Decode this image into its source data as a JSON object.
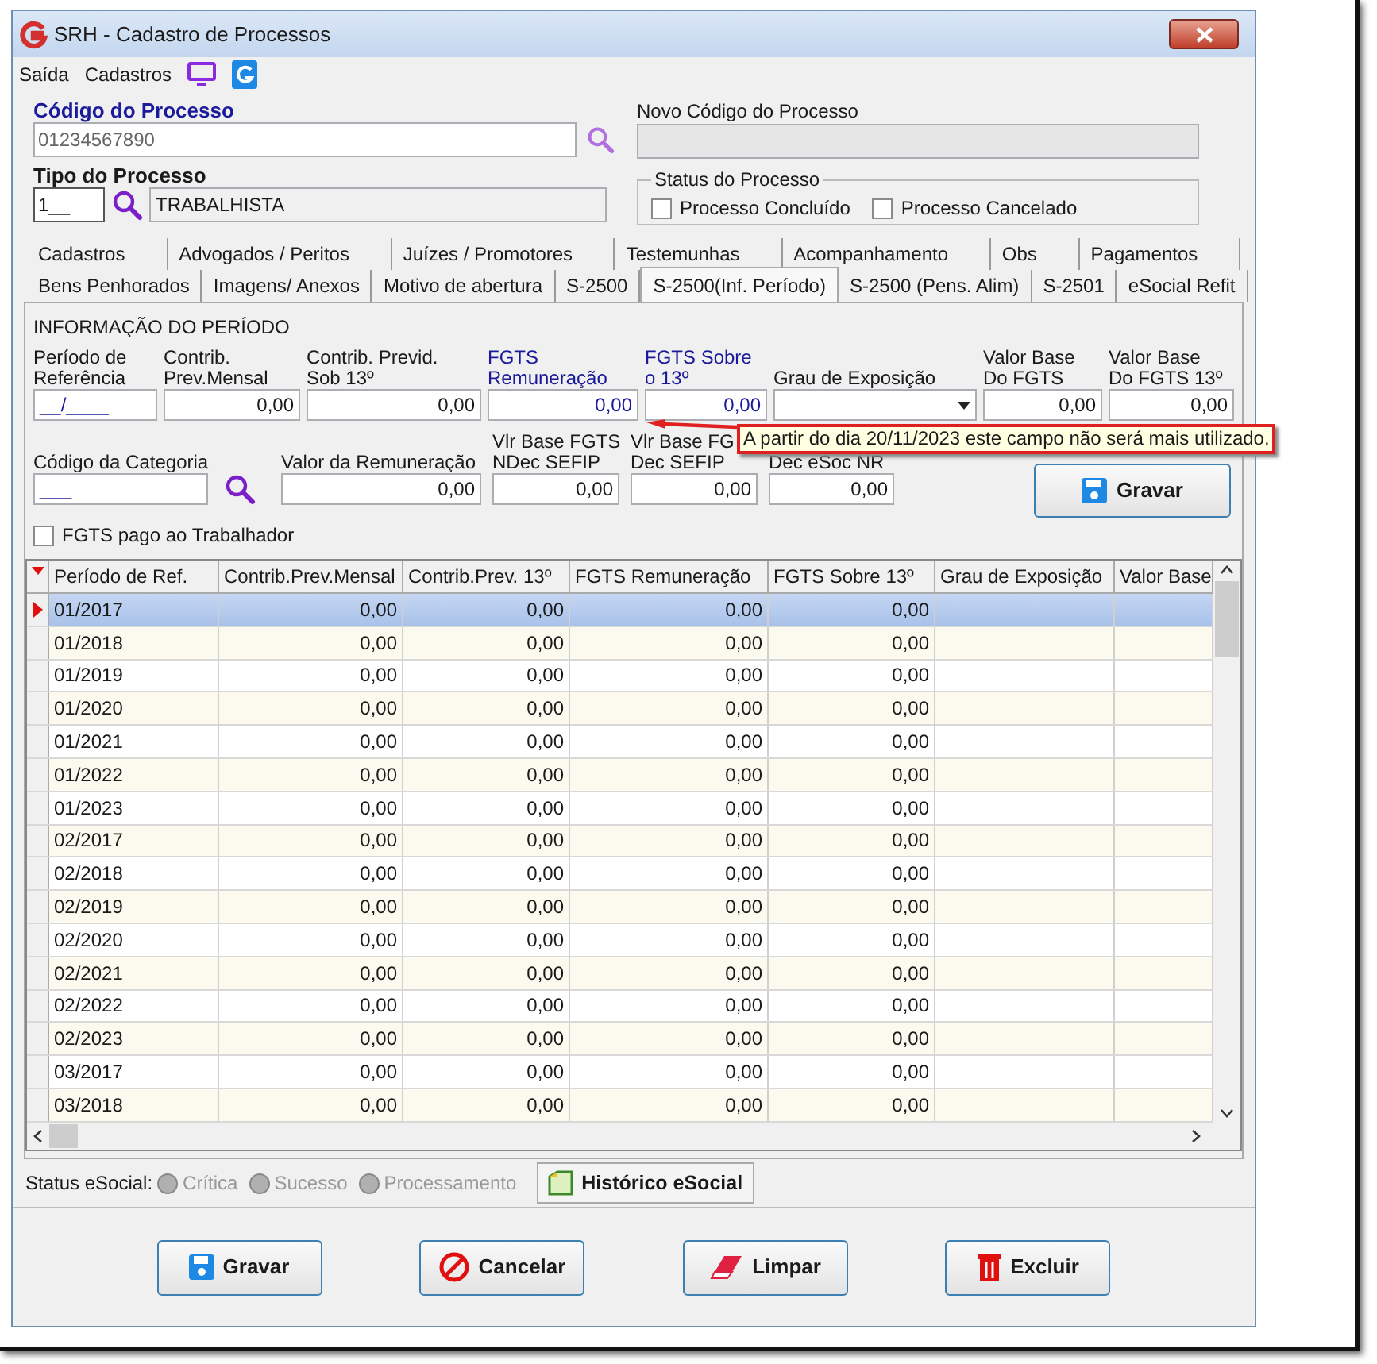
{
  "window": {
    "title": "SRH - Cadastro de Processos"
  },
  "menu": [
    {
      "label": "Saída",
      "kind": "text"
    },
    {
      "label": "Cadastros",
      "kind": "text"
    },
    {
      "kind": "monitor"
    },
    {
      "kind": "logo"
    }
  ],
  "codigo": {
    "label": "Código do Processo",
    "value": "01234567890"
  },
  "novo_codigo": {
    "label": "Novo Código do Processo",
    "disabled": true
  },
  "tipo": {
    "label": "Tipo do Processo",
    "code": "1__",
    "description": "TRABALHISTA"
  },
  "status": {
    "title": "Status do Processo",
    "options": [
      {
        "label": "Processo Concluído",
        "checked": false
      },
      {
        "label": "Processo Cancelado",
        "checked": false
      }
    ]
  },
  "tabs_row1": [
    {
      "label": "Cadastros",
      "selected": false
    },
    {
      "label": "Advogados / Peritos",
      "selected": false
    },
    {
      "label": "Juízes / Promotores",
      "selected": false
    },
    {
      "label": "Testemunhas",
      "selected": false
    },
    {
      "label": "Acompanhamento",
      "selected": false
    },
    {
      "label": "Obs",
      "selected": false
    },
    {
      "label": "Pagamentos",
      "selected": false
    }
  ],
  "tabs_row2": [
    {
      "label": "Bens Penhorados",
      "selected": false
    },
    {
      "label": "Imagens/ Anexos",
      "selected": false
    },
    {
      "label": "Motivo de abertura",
      "selected": false
    },
    {
      "label": "S-2500",
      "selected": false
    },
    {
      "label": "S-2500(Inf. Período)",
      "selected": true
    },
    {
      "label": "S-2500 (Pens. Alim)",
      "selected": false
    },
    {
      "label": "S-2501",
      "selected": false
    },
    {
      "label": "eSocial Refit",
      "selected": false
    }
  ],
  "group": {
    "title": "INFORMAÇÃO DO PERÍODO",
    "fields_row1": [
      {
        "label": [
          "Período de",
          "Referência"
        ],
        "value": "__/____",
        "kind": "mask",
        "highlight": false
      },
      {
        "label": [
          "Contrib.",
          "Prev.Mensal"
        ],
        "value": "0,00",
        "kind": "number",
        "highlight": false
      },
      {
        "label": [
          "Contrib. Previd.",
          "Sob 13º"
        ],
        "value": "0,00",
        "kind": "number",
        "highlight": false
      },
      {
        "label": [
          "FGTS",
          "Remuneração"
        ],
        "value": "0,00",
        "kind": "number",
        "highlight": true
      },
      {
        "label": [
          "FGTS Sobre",
          "o 13º"
        ],
        "value": "0,00",
        "kind": "number",
        "highlight": true
      },
      {
        "label": [
          "Grau de Exposição"
        ],
        "kind": "select",
        "highlight": false
      },
      {
        "label": [
          "Valor Base",
          "Do FGTS"
        ],
        "value": "0,00",
        "kind": "number",
        "highlight": false
      },
      {
        "label": [
          "Valor Base",
          "Do FGTS 13º"
        ],
        "value": "0,00",
        "kind": "number",
        "highlight": false
      }
    ],
    "tooltip": "A partir do dia 20/11/2023 este campo não será mais utilizado.",
    "fields_row2": [
      {
        "label": [
          "Código da Categoria"
        ],
        "value": "___",
        "kind": "lookup"
      },
      {
        "label": [
          "Valor da Remuneração"
        ],
        "value": "0,00",
        "kind": "number"
      },
      {
        "label": [
          "Vlr Base FGTS",
          "NDec SEFIP"
        ],
        "value": "0,00",
        "kind": "number"
      },
      {
        "label": [
          "Vlr Base FG",
          "Dec SEFIP"
        ],
        "value": "0,00",
        "kind": "number"
      },
      {
        "label": [
          "Dec eSoc NR"
        ],
        "value": "0,00",
        "kind": "number"
      }
    ],
    "save_button": "Gravar",
    "fgts_pago": {
      "label": "FGTS pago ao Trabalhador",
      "checked": false
    }
  },
  "table": {
    "columns": [
      "Período de Ref.",
      "Contrib.Prev.Mensal",
      "Contrib.Prev. 13º",
      "FGTS Remuneração",
      "FGTS Sobre 13º",
      "Grau de Exposição",
      "Valor Base"
    ],
    "rows": [
      {
        "cells": [
          "01/2017",
          "0,00",
          "0,00",
          "0,00",
          "0,00"
        ],
        "selected": true
      },
      {
        "cells": [
          "01/2018",
          "0,00",
          "0,00",
          "0,00",
          "0,00"
        ],
        "selected": false
      },
      {
        "cells": [
          "01/2019",
          "0,00",
          "0,00",
          "0,00",
          "0,00"
        ],
        "selected": false
      },
      {
        "cells": [
          "01/2020",
          "0,00",
          "0,00",
          "0,00",
          "0,00"
        ],
        "selected": false
      },
      {
        "cells": [
          "01/2021",
          "0,00",
          "0,00",
          "0,00",
          "0,00"
        ],
        "selected": false
      },
      {
        "cells": [
          "01/2022",
          "0,00",
          "0,00",
          "0,00",
          "0,00"
        ],
        "selected": false
      },
      {
        "cells": [
          "01/2023",
          "0,00",
          "0,00",
          "0,00",
          "0,00"
        ],
        "selected": false
      },
      {
        "cells": [
          "02/2017",
          "0,00",
          "0,00",
          "0,00",
          "0,00"
        ],
        "selected": false
      },
      {
        "cells": [
          "02/2018",
          "0,00",
          "0,00",
          "0,00",
          "0,00"
        ],
        "selected": false
      },
      {
        "cells": [
          "02/2019",
          "0,00",
          "0,00",
          "0,00",
          "0,00"
        ],
        "selected": false
      },
      {
        "cells": [
          "02/2020",
          "0,00",
          "0,00",
          "0,00",
          "0,00"
        ],
        "selected": false
      },
      {
        "cells": [
          "02/2021",
          "0,00",
          "0,00",
          "0,00",
          "0,00"
        ],
        "selected": false
      },
      {
        "cells": [
          "02/2022",
          "0,00",
          "0,00",
          "0,00",
          "0,00"
        ],
        "selected": false
      },
      {
        "cells": [
          "02/2023",
          "0,00",
          "0,00",
          "0,00",
          "0,00"
        ],
        "selected": false
      },
      {
        "cells": [
          "03/2017",
          "0,00",
          "0,00",
          "0,00",
          "0,00"
        ],
        "selected": false
      },
      {
        "cells": [
          "03/2018",
          "0,00",
          "0,00",
          "0,00",
          "0,00"
        ],
        "selected": false
      }
    ]
  },
  "status_esocial": {
    "label": "Status eSocial:",
    "options": [
      {
        "label": "Crítica",
        "disabled": true
      },
      {
        "label": "Sucesso",
        "disabled": true
      },
      {
        "label": "Processamento",
        "disabled": true
      }
    ],
    "history_button": "Histórico eSocial"
  },
  "buttons": [
    {
      "label": "Gravar",
      "kind": "save"
    },
    {
      "label": "Cancelar",
      "kind": "cancel"
    },
    {
      "label": "Limpar",
      "kind": "clear"
    },
    {
      "label": "Excluir",
      "kind": "delete"
    }
  ]
}
